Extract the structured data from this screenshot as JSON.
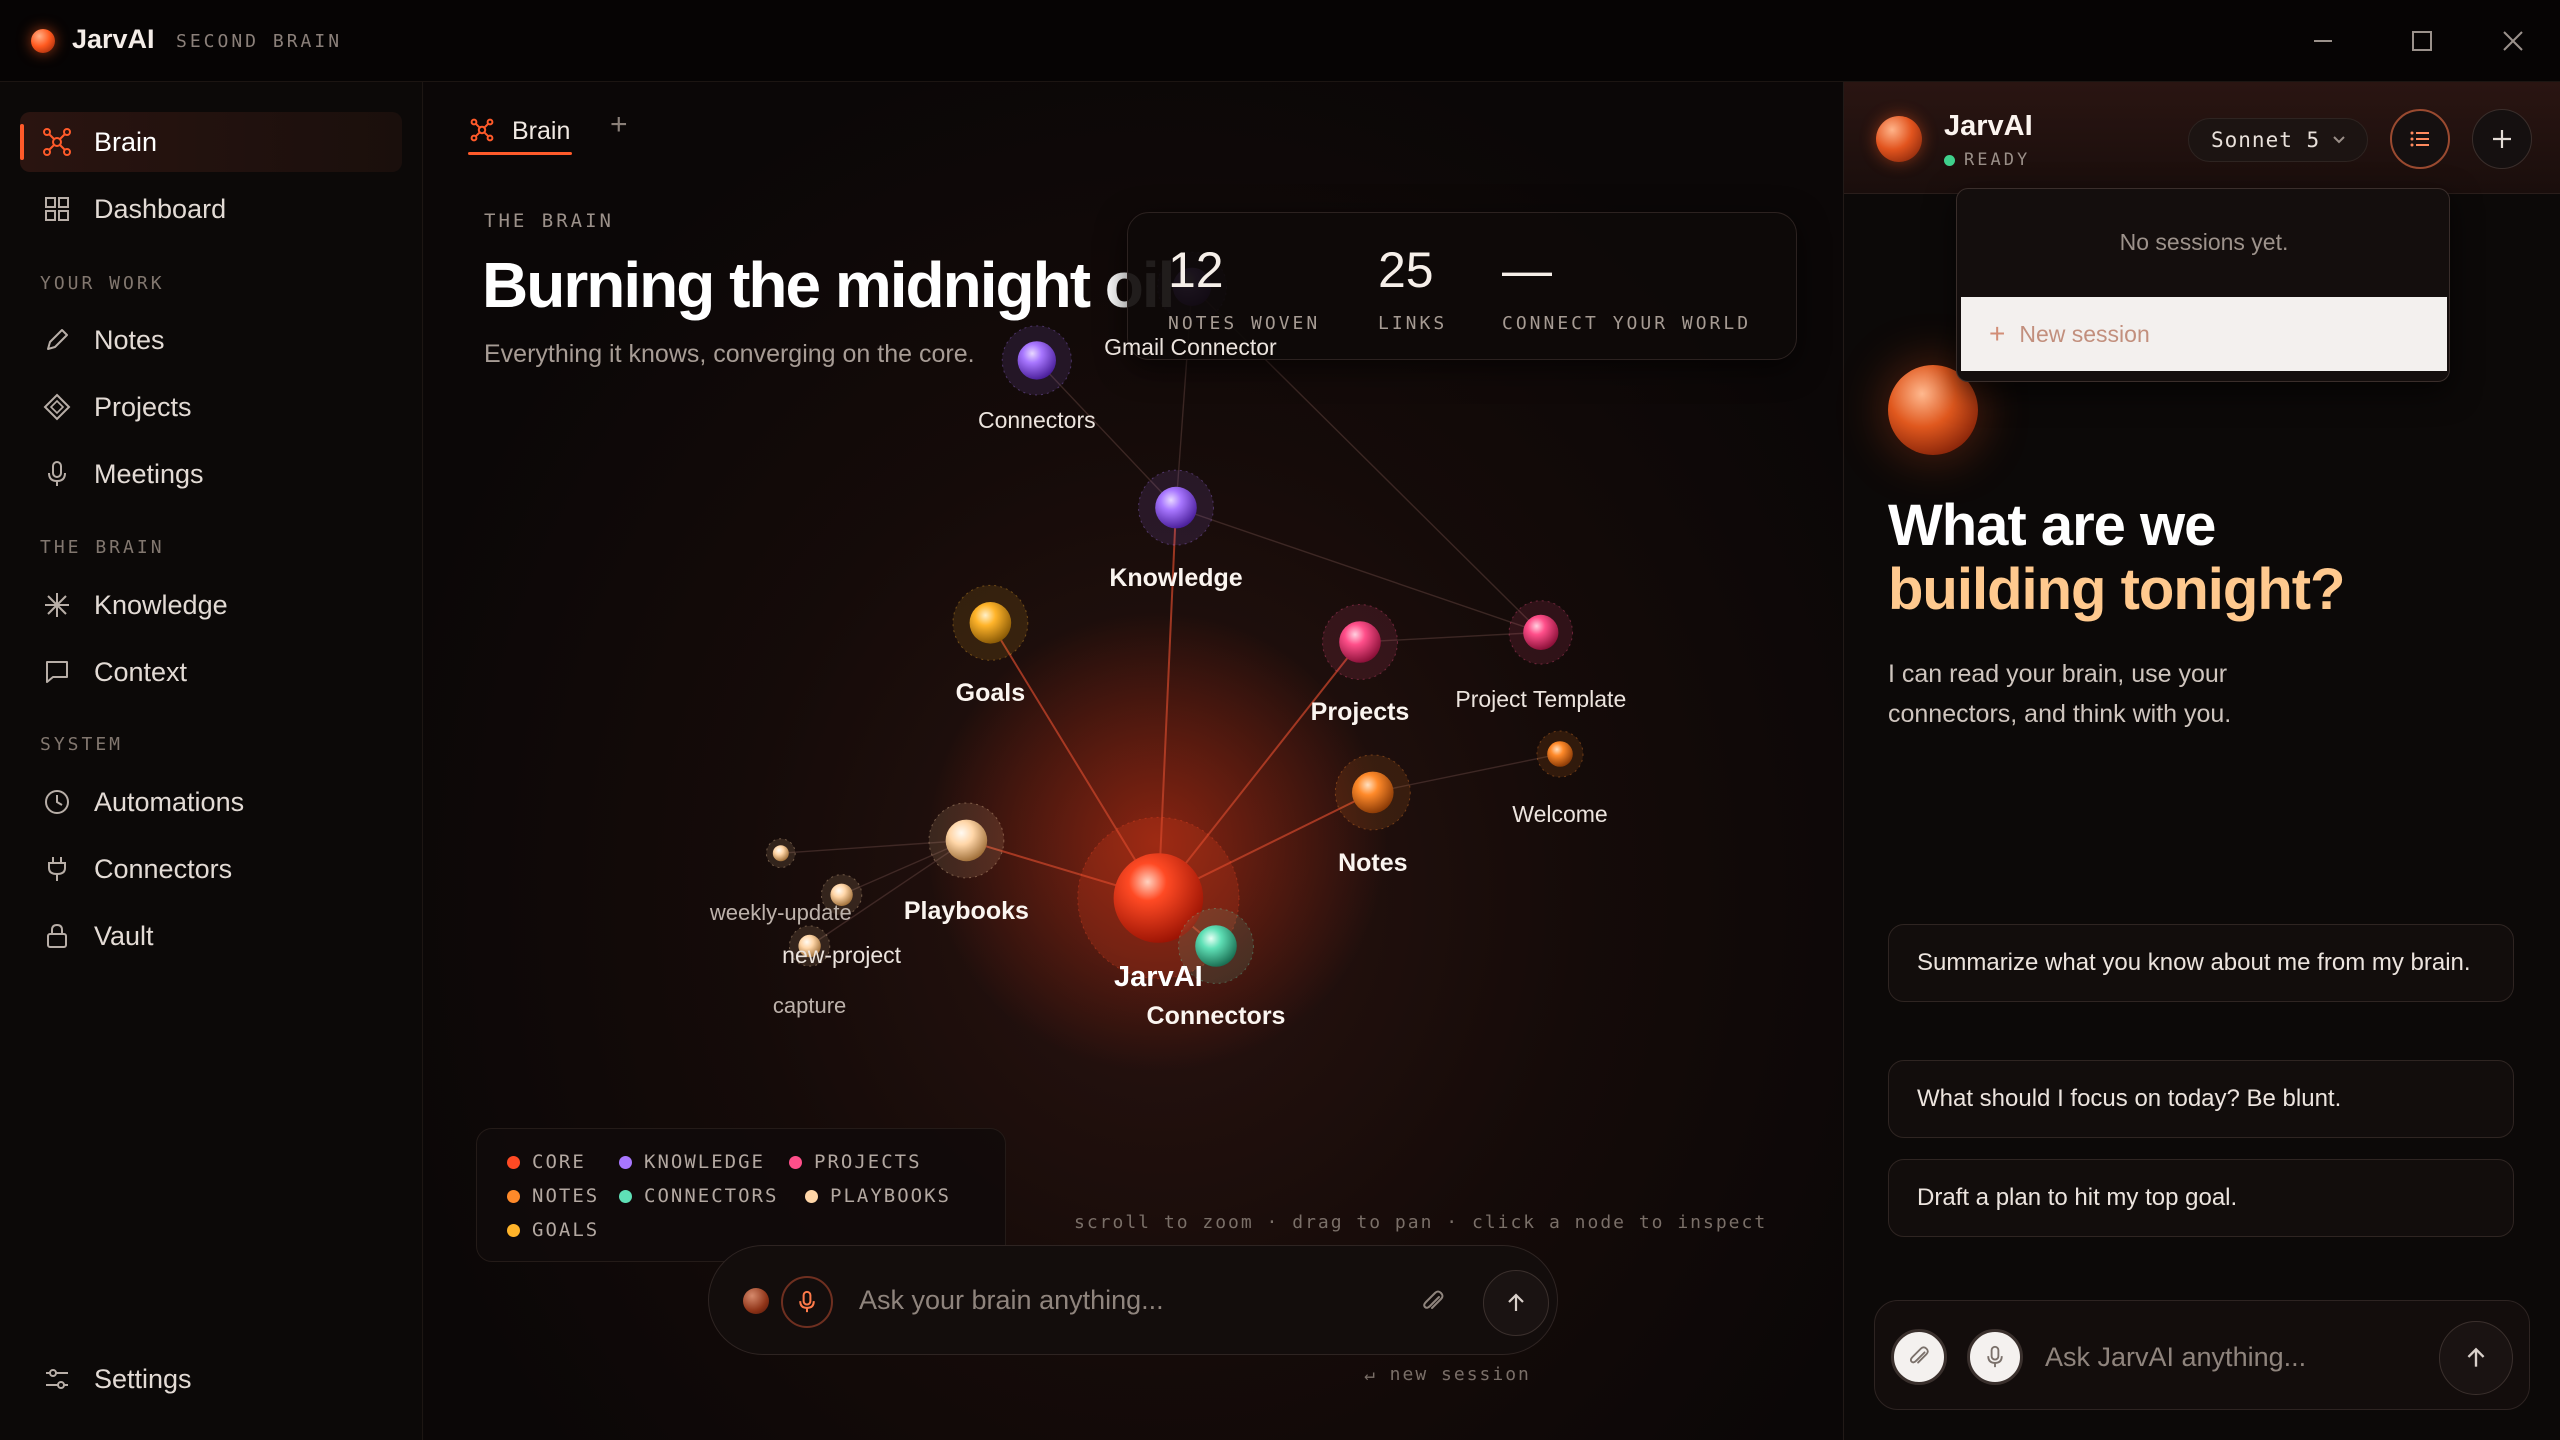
{
  "app": {
    "name": "JarvAI",
    "subtitle": "SECOND BRAIN"
  },
  "window": {
    "minimize": "—",
    "maximize": "☐",
    "close": "✕"
  },
  "sidebar": {
    "primary": [
      {
        "label": "Brain",
        "icon": "network-icon",
        "active": true
      },
      {
        "label": "Dashboard",
        "icon": "grid-icon"
      }
    ],
    "sections": [
      {
        "label": "YOUR WORK",
        "items": [
          {
            "label": "Notes",
            "icon": "pencil-icon"
          },
          {
            "label": "Projects",
            "icon": "diamond-icon"
          },
          {
            "label": "Meetings",
            "icon": "mic-icon"
          }
        ]
      },
      {
        "label": "THE BRAIN",
        "items": [
          {
            "label": "Knowledge",
            "icon": "sparkle-icon"
          },
          {
            "label": "Context",
            "icon": "message-icon"
          }
        ]
      },
      {
        "label": "SYSTEM",
        "items": [
          {
            "label": "Automations",
            "icon": "clock-icon"
          },
          {
            "label": "Connectors",
            "icon": "plug-icon"
          },
          {
            "label": "Vault",
            "icon": "lock-icon"
          }
        ]
      }
    ],
    "settings": {
      "label": "Settings",
      "icon": "sliders-icon"
    }
  },
  "main": {
    "tab": {
      "label": "Brain",
      "add": "+"
    },
    "eyebrow": "THE BRAIN",
    "headline": "Burning the midnight oil",
    "subline": "Everything it knows, converging on the core.",
    "stats": [
      {
        "value": "12",
        "label": "NOTES WOVEN"
      },
      {
        "value": "25",
        "label": "LINKS"
      },
      {
        "value": "—",
        "label": "CONNECT YOUR WORLD"
      }
    ],
    "graph": {
      "nodes": [
        {
          "label": "JarvAI",
          "type": "core"
        },
        {
          "label": "Knowledge",
          "type": "knowledge"
        },
        {
          "label": "Gmail Connector",
          "type": "knowledge"
        },
        {
          "label": "Connectors",
          "type": "knowledge"
        },
        {
          "label": "Goals",
          "type": "goals"
        },
        {
          "label": "Projects",
          "type": "projects"
        },
        {
          "label": "Project Template",
          "type": "projects"
        },
        {
          "label": "Notes",
          "type": "notes"
        },
        {
          "label": "Welcome",
          "type": "notes"
        },
        {
          "label": "Playbooks",
          "type": "playbooks"
        },
        {
          "label": "weekly-update",
          "type": "playbooks"
        },
        {
          "label": "new-project",
          "type": "playbooks"
        },
        {
          "label": "capture",
          "type": "playbooks"
        },
        {
          "label": "Connectors",
          "type": "connectors"
        }
      ]
    },
    "legend": [
      {
        "label": "CORE",
        "color": "#ff4a24"
      },
      {
        "label": "KNOWLEDGE",
        "color": "#a877ff"
      },
      {
        "label": "PROJECTS",
        "color": "#ff4f8a"
      },
      {
        "label": "NOTES",
        "color": "#ff8a2a"
      },
      {
        "label": "CONNECTORS",
        "color": "#5fe0b6"
      },
      {
        "label": "PLAYBOOKS",
        "color": "#ffd6a8"
      },
      {
        "label": "GOALS",
        "color": "#ffb42a"
      }
    ],
    "hint": "scroll to zoom · drag to pan · click a node to inspect",
    "composer": {
      "placeholder": "Ask your brain anything..."
    },
    "new_session_hint": "↵ new session"
  },
  "assistant": {
    "name": "JarvAI",
    "status": "READY",
    "model": "Sonnet 5",
    "sessions": {
      "empty": "No sessions yet.",
      "new": "New session"
    },
    "title_line1": "What are we",
    "title_line2": "building tonight?",
    "description": "I can read your brain, use your connectors, and think with you.",
    "suggestions": [
      "Summarize what you know about me from my brain.",
      "What should I focus on today? Be blunt.",
      "Draft a plan to hit my top goal."
    ],
    "composer": {
      "placeholder": "Ask JarvAI anything..."
    }
  },
  "colors": {
    "accent": "#ff5a2a",
    "gold": "#ffc98e",
    "ready": "#3fd08c"
  }
}
